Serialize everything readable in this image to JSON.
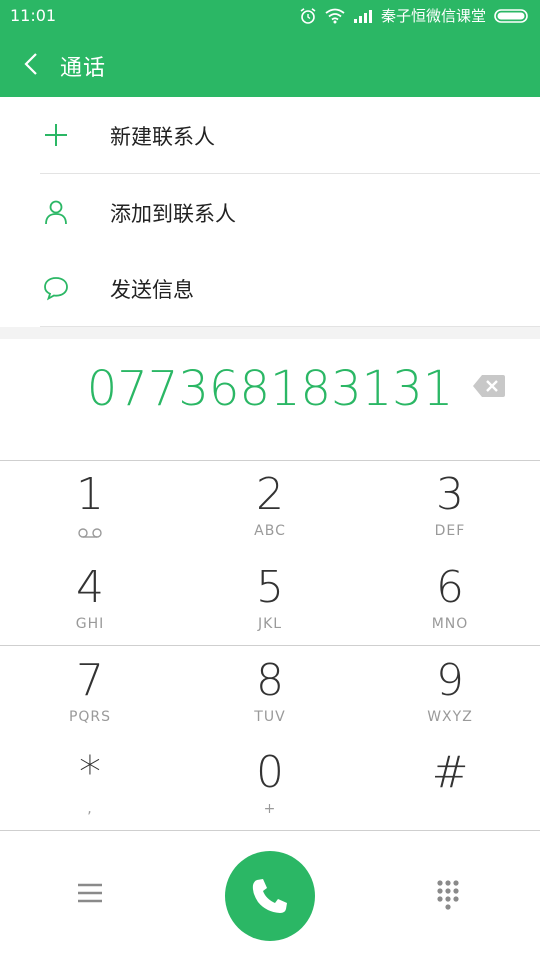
{
  "status": {
    "time": "11:01",
    "carrier": "秦子恒微信课堂"
  },
  "appbar": {
    "title": "通话"
  },
  "menu": {
    "items": [
      {
        "label": "新建联系人",
        "icon": "plus-icon"
      },
      {
        "label": "添加到联系人",
        "icon": "person-icon"
      },
      {
        "label": "发送信息",
        "icon": "message-icon"
      }
    ]
  },
  "dial": {
    "number": "077368183131"
  },
  "keypad": {
    "keys": [
      {
        "digit": "1",
        "letters": ""
      },
      {
        "digit": "2",
        "letters": "ABC"
      },
      {
        "digit": "3",
        "letters": "DEF"
      },
      {
        "digit": "4",
        "letters": "GHI"
      },
      {
        "digit": "5",
        "letters": "JKL"
      },
      {
        "digit": "6",
        "letters": "MNO"
      },
      {
        "digit": "7",
        "letters": "PQRS"
      },
      {
        "digit": "8",
        "letters": "TUV"
      },
      {
        "digit": "9",
        "letters": "WXYZ"
      },
      {
        "digit": "*",
        "letters": ","
      },
      {
        "digit": "0",
        "letters": "+"
      },
      {
        "digit": "#",
        "letters": ""
      }
    ]
  },
  "colors": {
    "accent": "#2bb765",
    "text": "#222222",
    "subtext": "#9a9a9a"
  }
}
